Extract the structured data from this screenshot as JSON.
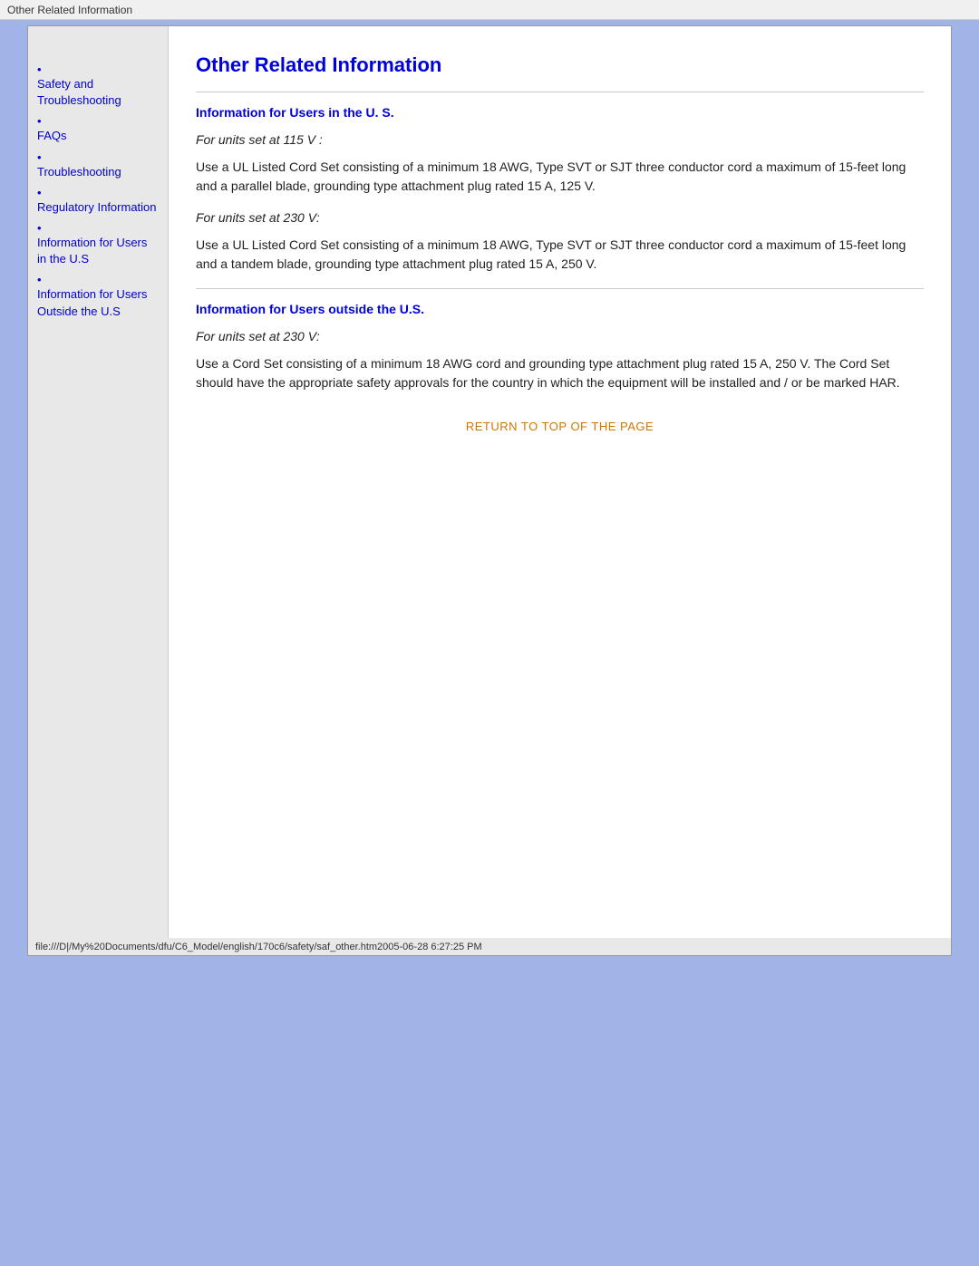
{
  "titleBar": {
    "text": "Other Related Information"
  },
  "sidebar": {
    "items": [
      {
        "id": "safety",
        "label": "Safety and Troubleshooting"
      },
      {
        "id": "faqs",
        "label": "FAQs"
      },
      {
        "id": "troubleshooting",
        "label": "Troubleshooting"
      },
      {
        "id": "regulatory",
        "label": "Regulatory Information"
      },
      {
        "id": "info-us",
        "label": "Information for Users in the U.S"
      },
      {
        "id": "info-outside",
        "label": "Information for Users Outside the U.S"
      }
    ]
  },
  "main": {
    "pageTitle": "Other Related Information",
    "section1": {
      "heading": "Information for Users in the U. S.",
      "block1": {
        "italic": "For units set at 115 V :",
        "body": "Use a UL Listed Cord Set consisting of a minimum 18 AWG, Type SVT or SJT three conductor cord a maximum of 15-feet long and a parallel blade, grounding type attachment plug rated 15 A, 125 V."
      },
      "block2": {
        "italic": "For units set at 230 V:",
        "body": "Use a UL Listed Cord Set consisting of a minimum 18 AWG, Type SVT or SJT three conductor cord a maximum of 15-feet long and a tandem blade, grounding type attachment plug rated 15 A, 250 V."
      }
    },
    "section2": {
      "heading": "Information for Users outside the U.S.",
      "block1": {
        "italic": "For units set at 230 V:",
        "body": "Use a Cord Set consisting of a minimum 18 AWG cord and grounding type attachment plug rated 15 A, 250 V. The Cord Set should have the appropriate safety approvals for the country in which the equipment will be installed and / or be marked HAR."
      }
    },
    "returnLink": "RETURN TO TOP OF THE PAGE"
  },
  "statusBar": {
    "text": "file:///D|/My%20Documents/dfu/C6_Model/english/170c6/safety/saf_other.htm2005-06-28 6:27:25 PM"
  }
}
